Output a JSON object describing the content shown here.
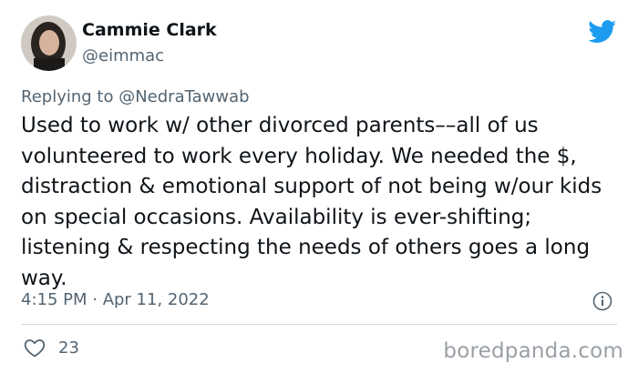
{
  "author": {
    "name": "Cammie Clark",
    "handle": "@eimmac"
  },
  "reply": {
    "prefix": "Replying to ",
    "mention": "@NedraTawwab"
  },
  "tweet": {
    "text": "Used to work w/ other divorced parents––all of us volunteered to work every holiday. We needed the $, distraction & emotional support of not being w/our kids on special occasions. Availability is ever-shifting; listening & respecting the needs of others goes a long way.",
    "timestamp": "4:15 PM · Apr 11, 2022"
  },
  "actions": {
    "like_count": "23"
  },
  "icons": {
    "brand": "twitter-bird-icon",
    "info": "info-icon",
    "like": "heart-icon"
  },
  "colors": {
    "twitter_blue": "#1d9bf0",
    "text": "#0f1419",
    "secondary": "#536471"
  },
  "watermark": "boredpanda.com"
}
